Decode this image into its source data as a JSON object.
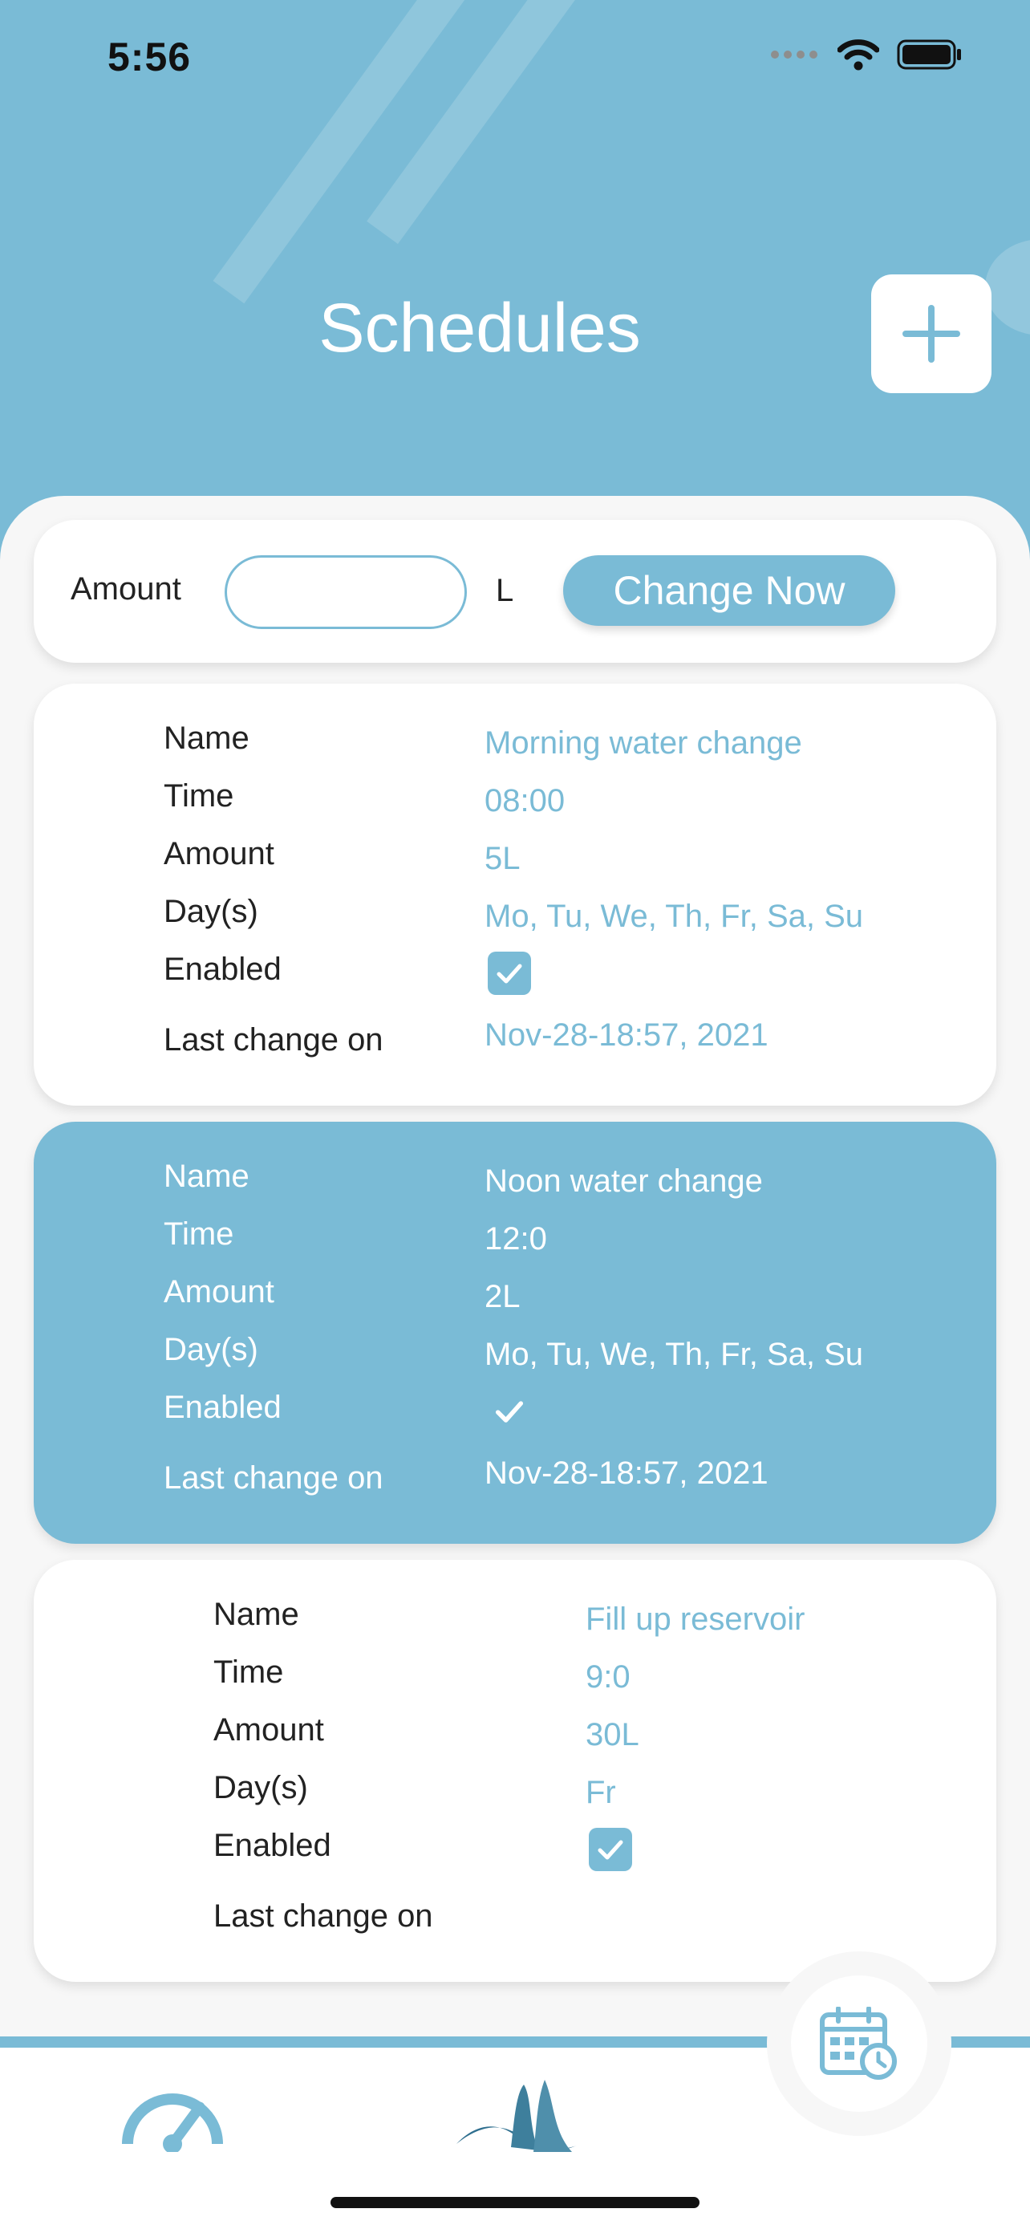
{
  "status_bar": {
    "time": "5:56"
  },
  "header": {
    "title": "Schedules"
  },
  "amount_bar": {
    "label": "Amount",
    "input_value": "",
    "unit": "L",
    "button_label": "Change Now"
  },
  "labels": {
    "name": "Name",
    "time": "Time",
    "amount": "Amount",
    "days": "Day(s)",
    "enabled": "Enabled",
    "last_change": "Last change on"
  },
  "schedules": [
    {
      "name": "Morning water change",
      "time": "08:00",
      "amount": "5L",
      "days": "Mo, Tu, We, Th, Fr, Sa, Su",
      "enabled": true,
      "last_change": "Nov-28-18:57, 2021"
    },
    {
      "name": "Noon water change",
      "time": "12:0",
      "amount": "2L",
      "days": "Mo, Tu, We, Th, Fr, Sa, Su",
      "enabled": true,
      "last_change": "Nov-28-18:57, 2021"
    },
    {
      "name": "Fill up reservoir",
      "time": "9:0",
      "amount": "30L",
      "days": "Fr",
      "enabled": true,
      "last_change": ""
    }
  ],
  "nav": {
    "items": [
      "speedometer-icon",
      "wave-logo-icon",
      "calendar-clock-icon"
    ],
    "active": "calendar-clock-icon"
  },
  "colors": {
    "accent": "#7abbd6",
    "dark_accent": "#2f6f8f",
    "background": "#f7f7f7"
  }
}
